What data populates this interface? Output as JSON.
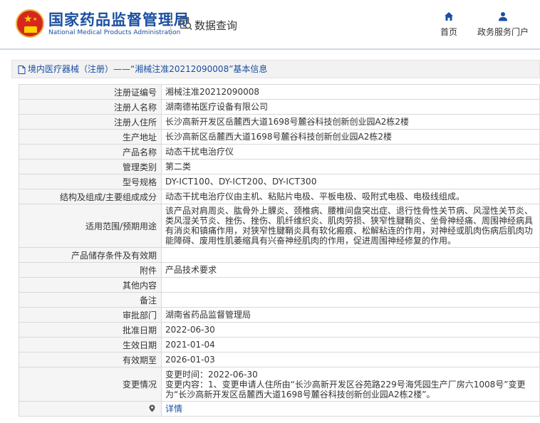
{
  "header": {
    "brand_cn": "国家药品监督管理局",
    "brand_en": "National Medical Products Administration",
    "query_label": "数据查询",
    "nav": [
      {
        "label": "首页",
        "icon": "home-icon"
      },
      {
        "label": "政务服务门户",
        "icon": "user-icon"
      }
    ]
  },
  "breadcrumb": "境内医疗器械（注册）——“湘械注准20212090008”基本信息",
  "rows": [
    {
      "label": "注册证编号",
      "value": "湘械注准20212090008"
    },
    {
      "label": "注册人名称",
      "value": "湖南德祐医疗设备有限公司"
    },
    {
      "label": "注册人住所",
      "value": "长沙高新开发区岳麓西大道1698号麓谷科技创新创业园A2栋2楼"
    },
    {
      "label": "生产地址",
      "value": "长沙高新区岳麓西大道1698号麓谷科技创新创业园A2栋2楼"
    },
    {
      "label": "产品名称",
      "value": "动态干扰电治疗仪"
    },
    {
      "label": "管理类别",
      "value": "第二类"
    },
    {
      "label": "型号规格",
      "value": "DY-ICT100、DY-ICT200、DY-ICT300"
    },
    {
      "label": "结构及组成/主要组成成分",
      "value": "动态干扰电治疗仪由主机、粘贴片电极、平板电极、吸附式电极、电极线组成。"
    },
    {
      "label": "适用范围/预期用途",
      "value": "该产品对肩周炎、肱骨外上髁炎、颈椎病、腰椎间盘突出症、退行性骨性关节病、风湿性关节炎、类风湿关节炎、挫伤、挫伤、肌纤维织炎、肌肉劳损、狭窄性腱鞘炎、坐骨神经痛、周围神经病具有消炎和镇痛作用，对狭窄性腱鞘炎具有软化瘢痕、松解粘连的作用，对神经或肌肉伤病后肌肉功能障碍、废用性肌萎缩具有兴奋神经肌肉的作用，促进周围神经修复的作用。"
    },
    {
      "label": "产品储存条件及有效期",
      "value": ""
    },
    {
      "label": "附件",
      "value": "产品技术要求"
    },
    {
      "label": "其他内容",
      "value": ""
    },
    {
      "label": "备注",
      "value": ""
    },
    {
      "label": "审批部门",
      "value": "湖南省药品监督管理局"
    },
    {
      "label": "批准日期",
      "value": "2022-06-30"
    },
    {
      "label": "生效日期",
      "value": "2021-01-04"
    },
    {
      "label": "有效期至",
      "value": "2026-01-03"
    }
  ],
  "change": {
    "label": "变更情况",
    "time": "变更时间：2022-06-30",
    "content": "变更内容：1、变更申请人住所由“长沙高新开发区谷苑路229号海凭园生产厂房六1008号”变更为“长沙高新开发区岳麓西大道1698号麓谷科技创新创业园A2栋2楼”。"
  },
  "detail_link": "详情",
  "colors": {
    "brand": "#1a4fa0",
    "label_bg": "#f5f5f5",
    "border": "#d9d9d9"
  }
}
